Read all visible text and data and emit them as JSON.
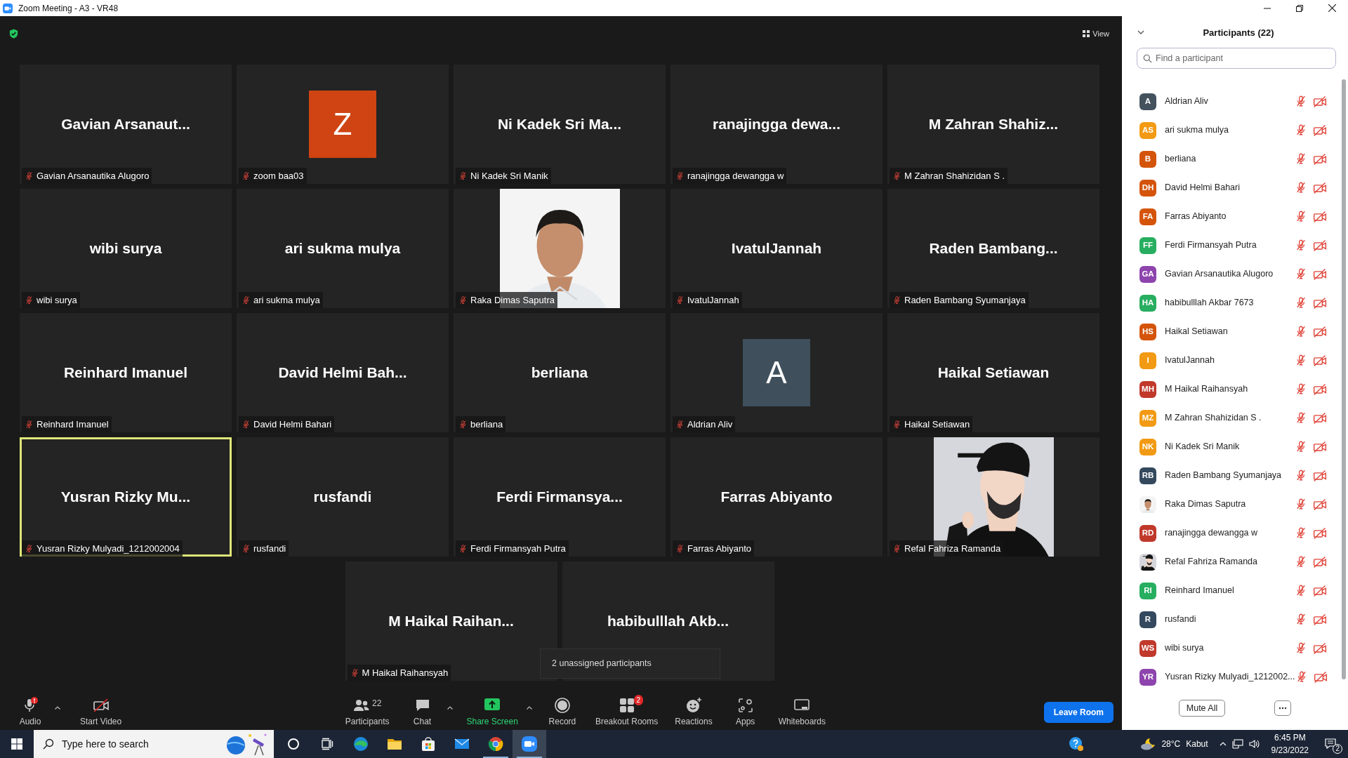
{
  "window": {
    "title": "Zoom Meeting - A3 - VR48"
  },
  "view_button": {
    "label": "View"
  },
  "tiles": [
    {
      "kind": "name",
      "display": "Gavian Arsanaut...",
      "label": "Gavian Arsanautika Alugoro",
      "muted": true,
      "highlighted": false
    },
    {
      "kind": "letter",
      "display": "Z",
      "color": "#cf4412",
      "label": "zoom baa03",
      "muted": true,
      "highlighted": false
    },
    {
      "kind": "name",
      "display": "Ni Kadek Sri Ma...",
      "label": "Ni Kadek Sri Manik",
      "muted": true,
      "highlighted": false
    },
    {
      "kind": "name",
      "display": "ranajingga dewa...",
      "label": "ranajingga dewangga w",
      "muted": true,
      "highlighted": false
    },
    {
      "kind": "name",
      "display": "M Zahran Shahiz...",
      "label": "M Zahran Shahizidan S .",
      "muted": true,
      "highlighted": false
    },
    {
      "kind": "name",
      "display": "wibi surya",
      "label": "wibi surya",
      "muted": true,
      "highlighted": false
    },
    {
      "kind": "name",
      "display": "ari sukma mulya",
      "label": "ari sukma mulya",
      "muted": true,
      "highlighted": false
    },
    {
      "kind": "picture",
      "label": "Raka Dimas Saputra",
      "muted": true,
      "highlighted": false
    },
    {
      "kind": "name",
      "display": "IvatulJannah",
      "label": "IvatulJannah",
      "muted": true,
      "highlighted": false
    },
    {
      "kind": "name",
      "display": "Raden Bambang...",
      "label": "Raden Bambang Syumanjaya",
      "muted": true,
      "highlighted": false
    },
    {
      "kind": "name",
      "display": "Reinhard Imanuel",
      "label": "Reinhard Imanuel",
      "muted": true,
      "highlighted": false
    },
    {
      "kind": "name",
      "display": "David Helmi Bah...",
      "label": "David Helmi Bahari",
      "muted": true,
      "highlighted": false
    },
    {
      "kind": "name",
      "display": "berliana",
      "label": "berliana",
      "muted": true,
      "highlighted": false
    },
    {
      "kind": "letter",
      "display": "A",
      "color": "#3f505c",
      "label": "Aldrian Aliv",
      "muted": true,
      "highlighted": false
    },
    {
      "kind": "name",
      "display": "Haikal Setiawan",
      "label": "Haikal Setiawan",
      "muted": true,
      "highlighted": false
    },
    {
      "kind": "name",
      "display": "Yusran Rizky Mu...",
      "label": "Yusran Rizky Mulyadi_1212002004",
      "muted": true,
      "highlighted": true
    },
    {
      "kind": "name",
      "display": "rusfandi",
      "label": "rusfandi",
      "muted": true,
      "highlighted": false
    },
    {
      "kind": "name",
      "display": "Ferdi Firmansya...",
      "label": "Ferdi Firmansyah Putra",
      "muted": true,
      "highlighted": false
    },
    {
      "kind": "name",
      "display": "Farras Abiyanto",
      "label": "Farras Abiyanto",
      "muted": true,
      "highlighted": false
    },
    {
      "kind": "picture",
      "label": "Refal Fahriza Ramanda",
      "muted": true,
      "highlighted": false
    },
    {
      "kind": "name",
      "display": "M Haikal Raihan...",
      "label": "M Haikal Raihansyah",
      "muted": true,
      "highlighted": false
    },
    {
      "kind": "name",
      "display": "habibulllah Akb...",
      "highlighted": false
    }
  ],
  "tooltip": "2 unassigned participants",
  "toolbar": [
    {
      "kind": "audio",
      "label": "Audio",
      "menu_caret": true,
      "accent": false
    },
    {
      "kind": "video",
      "label": "Start Video",
      "accent": false
    },
    {
      "kind": "participants",
      "label": "Participants",
      "count": "22",
      "accent": false
    },
    {
      "kind": "chat",
      "label": "Chat",
      "menu_caret": true,
      "accent": false
    },
    {
      "kind": "share",
      "label": "Share Screen",
      "menu_caret": true,
      "accent": true
    },
    {
      "kind": "record",
      "label": "Record",
      "accent": false
    },
    {
      "kind": "breakout",
      "label": "Breakout Rooms",
      "badge": "2",
      "accent": false
    },
    {
      "kind": "reactions",
      "label": "Reactions",
      "accent": false
    },
    {
      "kind": "apps",
      "label": "Apps",
      "accent": false
    },
    {
      "kind": "whiteboards",
      "label": "Whiteboards",
      "accent": false
    }
  ],
  "leave_button": {
    "label": "Leave Room"
  },
  "panel": {
    "title": "Participants (22)",
    "search": {
      "placeholder": "Find a participant"
    },
    "participants": [
      {
        "kind": "initials",
        "initials": "A",
        "color": "#44525e",
        "name": "Aldrian Aliv",
        "muted": true,
        "video_off": true
      },
      {
        "kind": "initials",
        "initials": "AS",
        "color": "#f29a13",
        "name": "ari sukma mulya",
        "muted": true,
        "video_off": true
      },
      {
        "kind": "initials",
        "initials": "B",
        "color": "#d4540a",
        "name": "berliana",
        "muted": true,
        "video_off": true
      },
      {
        "kind": "initials",
        "initials": "DH",
        "color": "#d4540a",
        "name": "David Helmi Bahari",
        "muted": true,
        "video_off": true
      },
      {
        "kind": "initials",
        "initials": "FA",
        "color": "#d4540a",
        "name": "Farras Abiyanto",
        "muted": true,
        "video_off": true
      },
      {
        "kind": "initials",
        "initials": "FF",
        "color": "#27ae60",
        "name": "Ferdi Firmansyah Putra",
        "muted": true,
        "video_off": true
      },
      {
        "kind": "initials",
        "initials": "GA",
        "color": "#8e44ad",
        "name": "Gavian Arsanautika Alugoro",
        "muted": true,
        "video_off": true
      },
      {
        "kind": "initials",
        "initials": "HA",
        "color": "#27ae60",
        "name": "habibulllah Akbar 7673",
        "muted": true,
        "video_off": true
      },
      {
        "kind": "initials",
        "initials": "HS",
        "color": "#d4540a",
        "name": "Haikal Setiawan",
        "muted": true,
        "video_off": true
      },
      {
        "kind": "initials",
        "initials": "I",
        "color": "#f29a13",
        "name": "IvatulJannah",
        "muted": true,
        "video_off": true
      },
      {
        "kind": "initials",
        "initials": "MH",
        "color": "#c0392b",
        "name": "M Haikal Raihansyah",
        "muted": true,
        "video_off": true
      },
      {
        "kind": "initials",
        "initials": "MZ",
        "color": "#f29a13",
        "name": "M Zahran Shahizidan S .",
        "muted": true,
        "video_off": true
      },
      {
        "kind": "initials",
        "initials": "NK",
        "color": "#f29a13",
        "name": "Ni Kadek Sri Manik",
        "muted": true,
        "video_off": true
      },
      {
        "kind": "initials",
        "initials": "RB",
        "color": "#34495e",
        "name": "Raden Bambang Syumanjaya",
        "muted": true,
        "video_off": true
      },
      {
        "kind": "picture",
        "name": "Raka Dimas Saputra",
        "muted": true,
        "video_off": true
      },
      {
        "kind": "initials",
        "initials": "RD",
        "color": "#c0392b",
        "name": "ranajingga dewangga w",
        "muted": true,
        "video_off": true
      },
      {
        "kind": "picture",
        "name": "Refal Fahriza Ramanda",
        "muted": true,
        "video_off": true
      },
      {
        "kind": "initials",
        "initials": "RI",
        "color": "#27ae60",
        "name": "Reinhard Imanuel",
        "muted": true,
        "video_off": true
      },
      {
        "kind": "initials",
        "initials": "R",
        "color": "#34495e",
        "name": "rusfandi",
        "muted": true,
        "video_off": true
      },
      {
        "kind": "initials",
        "initials": "WS",
        "color": "#c0392b",
        "name": "wibi surya",
        "muted": true,
        "video_off": true
      },
      {
        "kind": "initials",
        "initials": "YR",
        "color": "#8e44ad",
        "name": "Yusran Rizky Mulyadi_1212002...",
        "muted": true,
        "video_off": true
      }
    ],
    "mute_all_button": {
      "label": "Mute All"
    }
  },
  "taskbar": {
    "search": {
      "placeholder": "Type here to search"
    },
    "apps": [
      {
        "kind": "cortana",
        "running": false,
        "selected": false
      },
      {
        "kind": "taskview",
        "running": false,
        "selected": false
      },
      {
        "kind": "edge",
        "running": false,
        "selected": false
      },
      {
        "kind": "explorer",
        "running": false,
        "selected": false
      },
      {
        "kind": "store",
        "running": false,
        "selected": false
      },
      {
        "kind": "mail",
        "running": false,
        "selected": false
      },
      {
        "kind": "chrome",
        "running": true,
        "selected": false
      },
      {
        "kind": "zoom",
        "running": true,
        "selected": true
      }
    ],
    "temperature": "28°C",
    "weather": "Kabut",
    "time": "6:45 PM",
    "date": "9/23/2022",
    "notifications": "2"
  }
}
